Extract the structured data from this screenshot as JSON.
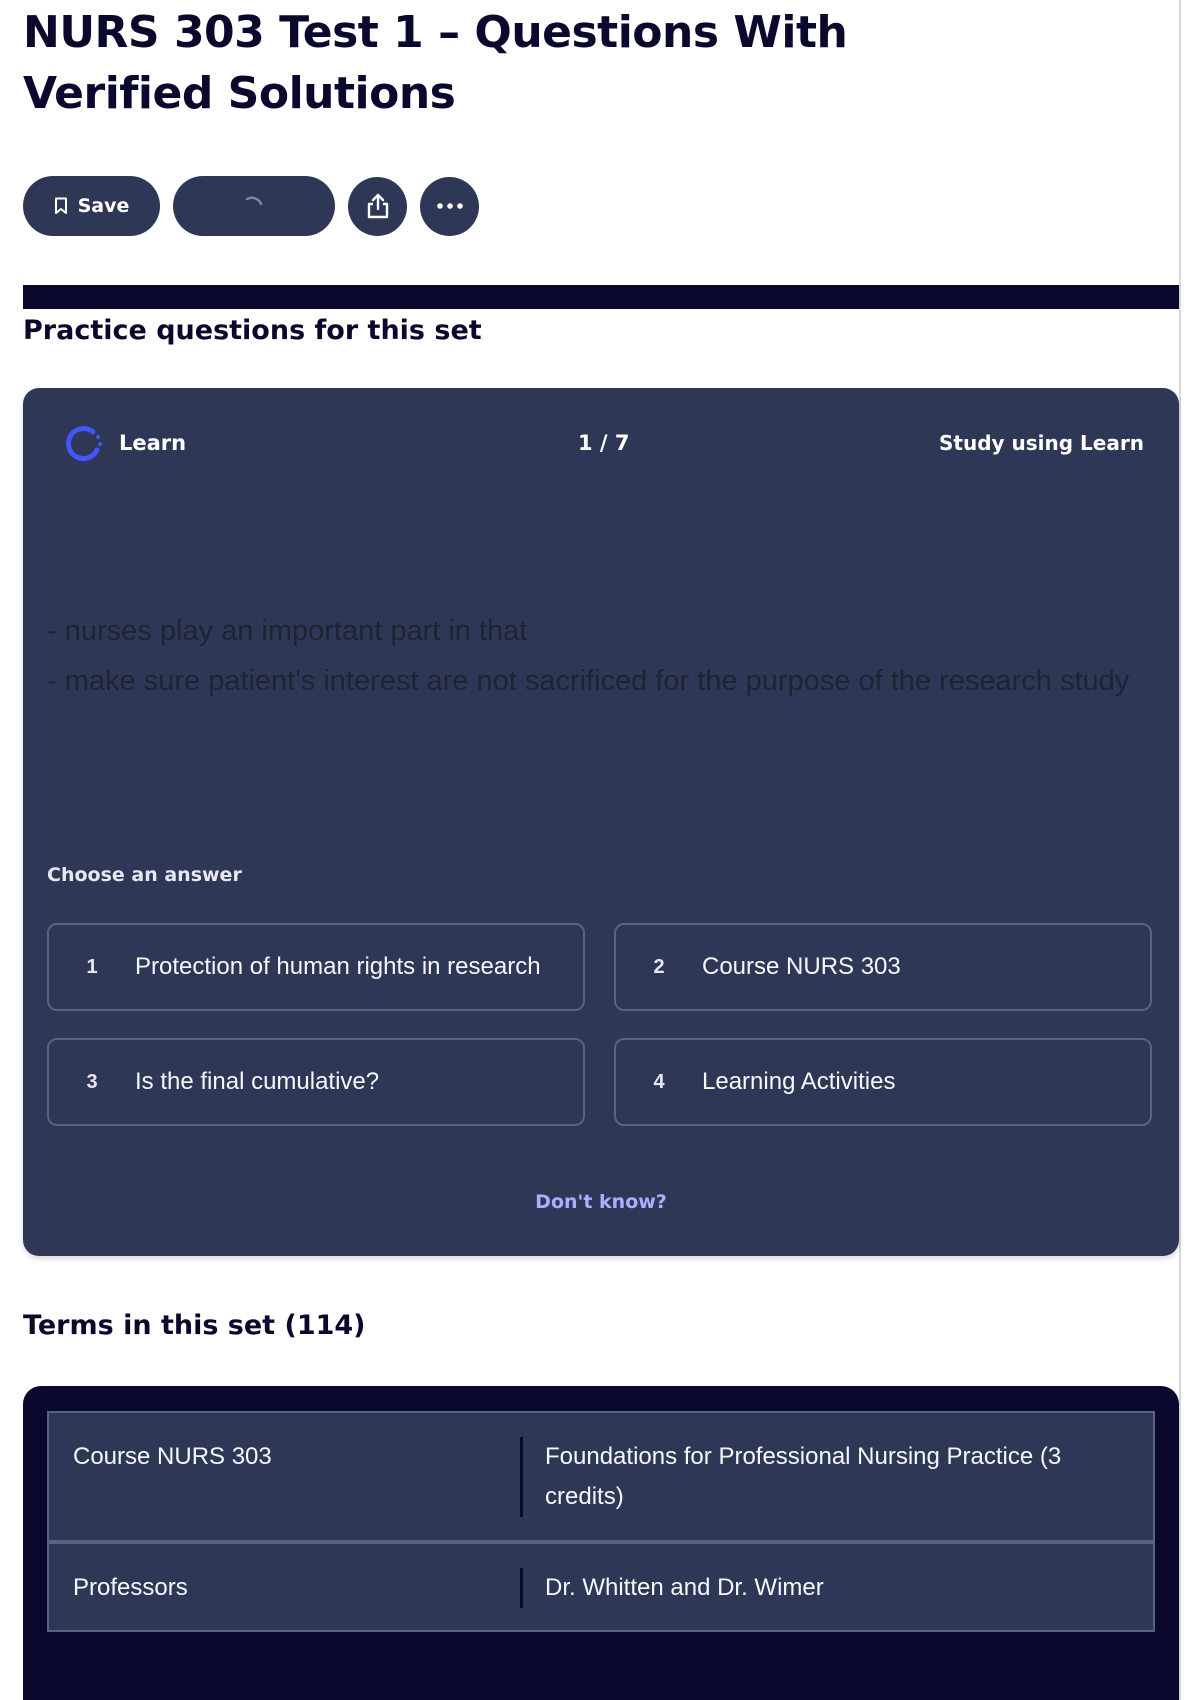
{
  "header": {
    "title": "NURS 303 Test 1 – Questions With Verified Solutions"
  },
  "toolbar": {
    "save_label": "Save",
    "save_icon": "bookmark-icon",
    "loading_icon": "spinner-icon",
    "share_icon": "share-icon",
    "more_icon": "more-icon"
  },
  "practice": {
    "heading": "Practice questions for this set",
    "mode_label": "Learn",
    "mode_icon": "learn-icon",
    "progress": "1 / 7",
    "study_link": "Study using Learn",
    "question_lines": [
      "- nurses play an important part in that",
      "- make sure patient's interest are not sacrificed for the purpose of the research study"
    ],
    "choose_label": "Choose an answer",
    "answers": [
      {
        "number": "1",
        "text": "Protection of human rights in research"
      },
      {
        "number": "2",
        "text": "Course NURS 303"
      },
      {
        "number": "3",
        "text": "Is the final cumulative?"
      },
      {
        "number": "4",
        "text": "Learning Activities"
      }
    ],
    "dont_know": "Don't know?"
  },
  "terms": {
    "heading": "Terms in this set (114)",
    "rows": [
      {
        "term": "Course NURS 303",
        "definition": "Foundations for Professional Nursing Practice (3 credits)"
      },
      {
        "term": "Professors",
        "definition": "Dr. Whitten and Dr. Wimer"
      }
    ]
  },
  "colors": {
    "brand_dark": "#0a092d",
    "card_bg": "#2e3856",
    "border": "#586380",
    "link": "#a8b1ff",
    "learn_icon": "#4255ff"
  }
}
